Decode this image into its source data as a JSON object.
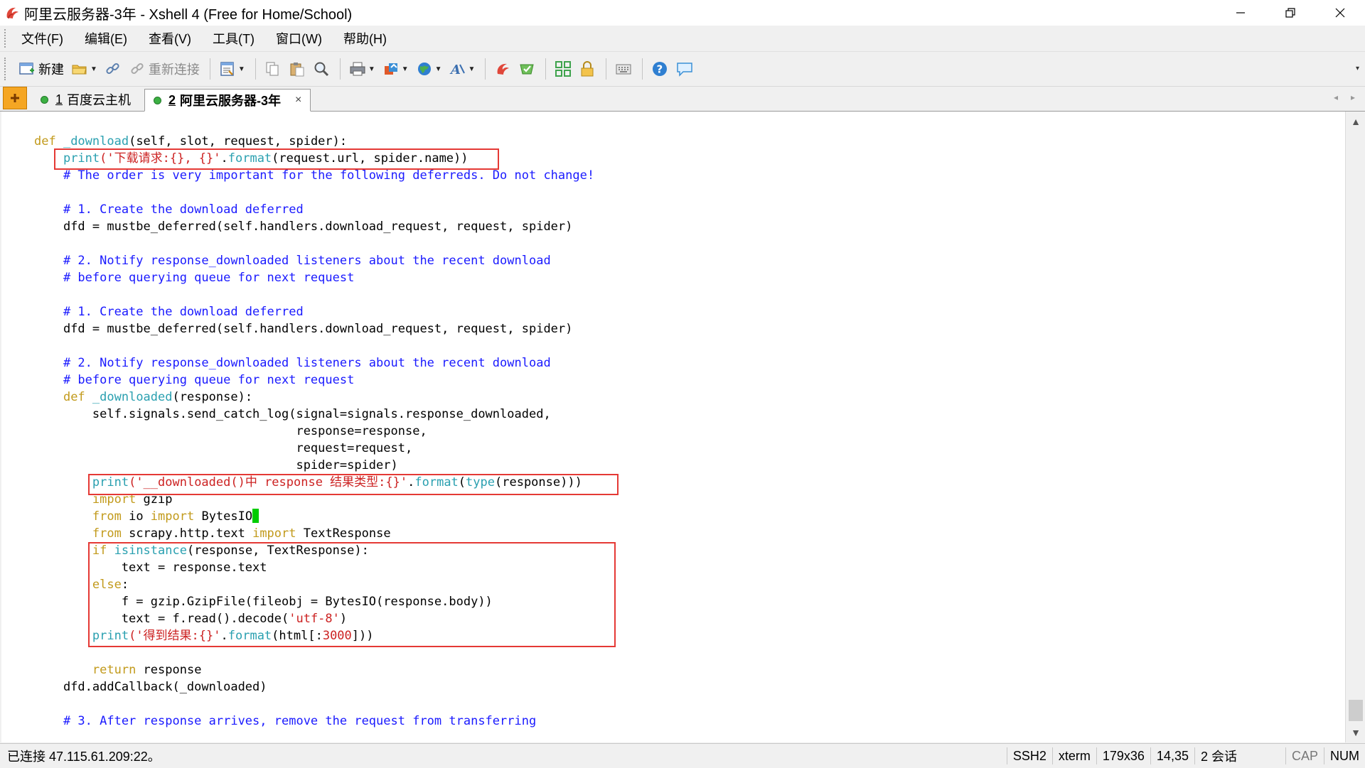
{
  "window": {
    "title": "阿里云服务器-3年 - Xshell 4 (Free for Home/School)",
    "controls": {
      "minimize": "—",
      "restore": "❐",
      "close": "✕"
    }
  },
  "menu": {
    "items": [
      {
        "label": "文件(F)"
      },
      {
        "label": "编辑(E)"
      },
      {
        "label": "查看(V)"
      },
      {
        "label": "工具(T)"
      },
      {
        "label": "窗口(W)"
      },
      {
        "label": "帮助(H)"
      }
    ]
  },
  "toolbar": {
    "new_label": "新建",
    "reconnect_label": "重新连接",
    "icons": [
      "new-session-icon",
      "open-folder-icon",
      "link-icon",
      "reconnect-icon",
      "properties-icon",
      "copy-icon",
      "paste-icon",
      "find-icon",
      "print-icon",
      "transfer-icon",
      "globe-icon",
      "font-icon",
      "xftp-icon",
      "xmanager-icon",
      "layout-icon",
      "lock-icon",
      "keyboard-icon",
      "help-icon",
      "chat-icon"
    ],
    "overflow": "▾"
  },
  "tabs": {
    "add_icon": "add-tab-icon",
    "items": [
      {
        "num": "1",
        "label": "百度云主机",
        "active": false
      },
      {
        "num": "2",
        "label": "阿里云服务器-3年",
        "active": true,
        "close": "×"
      }
    ],
    "arrows": [
      "◂",
      "▸"
    ]
  },
  "terminal": {
    "lines": [
      [
        [
          "kw",
          "def "
        ],
        [
          "fn",
          "_download"
        ],
        [
          "",
          "(self, slot, request, spider):"
        ]
      ],
      [
        [
          "",
          "    "
        ],
        [
          "fn",
          "print"
        ],
        [
          "str",
          "('下载请求:{}, {}'"
        ],
        [
          "",
          "."
        ],
        [
          "fn",
          "format"
        ],
        [
          "",
          "(request.url, spider.name))"
        ]
      ],
      [
        [
          "cm",
          "    # The order is very important for the following deferreds. Do not change!"
        ]
      ],
      [
        [
          "",
          ""
        ]
      ],
      [
        [
          "cm",
          "    # 1. Create the download deferred"
        ]
      ],
      [
        [
          "",
          "    dfd = mustbe_deferred(self.handlers.download_request, request, spider)"
        ]
      ],
      [
        [
          "",
          ""
        ]
      ],
      [
        [
          "cm",
          "    # 2. Notify response_downloaded listeners about the recent download"
        ]
      ],
      [
        [
          "cm",
          "    # before querying queue for next request"
        ]
      ],
      [
        [
          "",
          ""
        ]
      ],
      [
        [
          "cm",
          "    # 1. Create the download deferred"
        ]
      ],
      [
        [
          "",
          "    dfd = mustbe_deferred(self.handlers.download_request, request, spider)"
        ]
      ],
      [
        [
          "",
          ""
        ]
      ],
      [
        [
          "cm",
          "    # 2. Notify response_downloaded listeners about the recent download"
        ]
      ],
      [
        [
          "cm",
          "    # before querying queue for next request"
        ]
      ],
      [
        [
          "",
          "    "
        ],
        [
          "kw",
          "def "
        ],
        [
          "fn",
          "_downloaded"
        ],
        [
          "",
          "(response):"
        ]
      ],
      [
        [
          "",
          "        self.signals.send_catch_log(signal=signals.response_downloaded,"
        ]
      ],
      [
        [
          "",
          "                                    response=response,"
        ]
      ],
      [
        [
          "",
          "                                    request=request,"
        ]
      ],
      [
        [
          "",
          "                                    spider=spider)"
        ]
      ],
      [
        [
          "",
          "        "
        ],
        [
          "fn",
          "print"
        ],
        [
          "str",
          "('__downloaded()中 response 结果类型:{}'"
        ],
        [
          "",
          "."
        ],
        [
          "fn",
          "format"
        ],
        [
          "",
          "("
        ],
        [
          "fn",
          "type"
        ],
        [
          "",
          "(response)))"
        ]
      ],
      [
        [
          "",
          "        "
        ],
        [
          "kw",
          "import"
        ],
        [
          "",
          " gzip"
        ]
      ],
      [
        [
          "",
          "        "
        ],
        [
          "kw",
          "from"
        ],
        [
          "",
          " io "
        ],
        [
          "kw",
          "import"
        ],
        [
          "",
          " BytesIO"
        ],
        [
          "cursor",
          ""
        ]
      ],
      [
        [
          "",
          "        "
        ],
        [
          "kw",
          "from"
        ],
        [
          "",
          " scrapy.http.text "
        ],
        [
          "kw",
          "import"
        ],
        [
          "",
          " TextResponse"
        ]
      ],
      [
        [
          "",
          "        "
        ],
        [
          "kw",
          "if "
        ],
        [
          "fn",
          "isinstance"
        ],
        [
          "",
          "(response, TextResponse):"
        ]
      ],
      [
        [
          "",
          "            text = response.text"
        ]
      ],
      [
        [
          "",
          "        "
        ],
        [
          "kw",
          "else"
        ],
        [
          "",
          ":"
        ]
      ],
      [
        [
          "",
          "            f = gzip.GzipFile(fileobj = BytesIO(response.body))"
        ]
      ],
      [
        [
          "",
          "            text = f.read().decode("
        ],
        [
          "str",
          "'utf-8'"
        ],
        [
          "",
          ")"
        ]
      ],
      [
        [
          "",
          "        "
        ],
        [
          "fn",
          "print"
        ],
        [
          "str",
          "('得到结果:{}'"
        ],
        [
          "",
          "."
        ],
        [
          "fn",
          "format"
        ],
        [
          "",
          "(html[:"
        ],
        [
          "num",
          "3000"
        ],
        [
          "",
          "]))"
        ]
      ],
      [
        [
          "",
          ""
        ]
      ],
      [
        [
          "",
          "        "
        ],
        [
          "kw",
          "return"
        ],
        [
          "",
          " response"
        ]
      ],
      [
        [
          "",
          "    dfd.addCallback(_downloaded)"
        ]
      ],
      [
        [
          "",
          ""
        ]
      ],
      [
        [
          "cm",
          "    # 3. After response arrives, remove the request from transferring"
        ]
      ]
    ]
  },
  "statusbar": {
    "connection": "已连接 47.115.61.209:22。",
    "protocol": "SSH2",
    "term": "xterm",
    "size": "179x36",
    "cursor": "14,35",
    "sessions": "2 会话",
    "cap": "CAP",
    "num": "NUM"
  },
  "colors": {
    "keyword": "#c29a1b",
    "function": "#2aa0b0",
    "string": "#cc2222",
    "comment": "#1a1aff",
    "highlight_box": "#e53935",
    "cursor": "#00cc00"
  }
}
